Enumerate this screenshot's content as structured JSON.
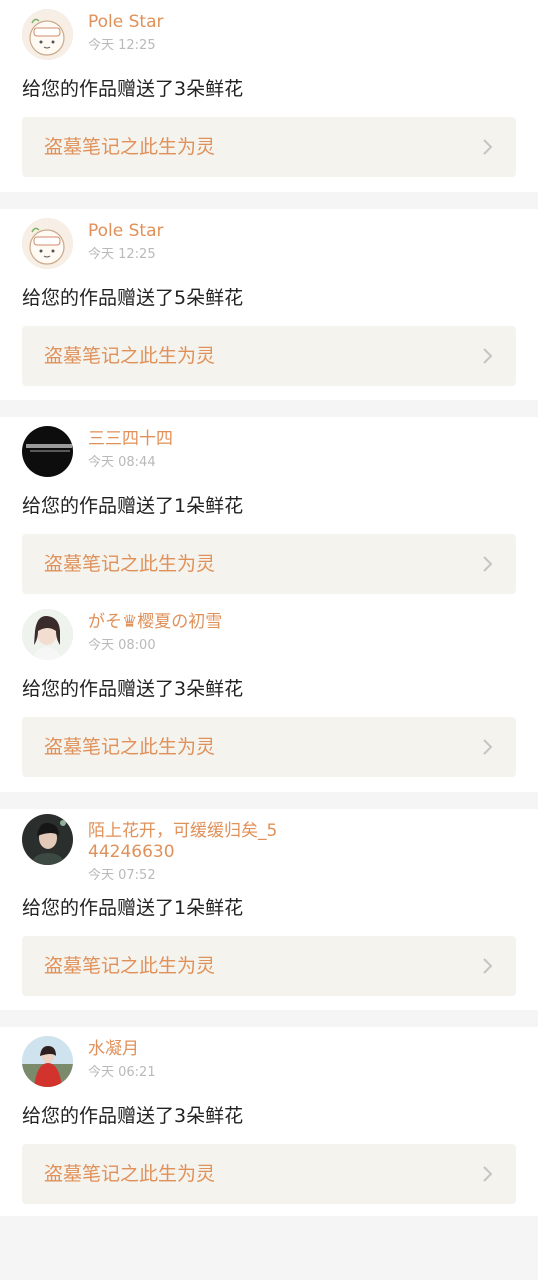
{
  "notifications": [
    {
      "avatar": "avatar-cartoon",
      "user": "Pole Star",
      "time": "今天 12:25",
      "message": "给您的作品赠送了3朵鲜花",
      "work": "盗墓笔记之此生为灵"
    },
    {
      "avatar": "avatar-cartoon",
      "user": "Pole Star",
      "time": "今天 12:25",
      "message": "给您的作品赠送了5朵鲜花",
      "work": "盗墓笔记之此生为灵"
    },
    {
      "avatar": "avatar-dark",
      "user": "三三四十四",
      "time": "今天 08:44",
      "message": "给您的作品赠送了1朵鲜花",
      "work": "盗墓笔记之此生为灵"
    },
    {
      "avatar": "avatar-girl",
      "user": "がそ♛樱夏の初雪",
      "time": "今天 08:00",
      "message": "给您的作品赠送了3朵鲜花",
      "work": "盗墓笔记之此生为灵"
    },
    {
      "avatar": "avatar-portrait",
      "user": "陌上花开，可缓缓归矣_544246630",
      "time": "今天 07:52",
      "message": "给您的作品赠送了1朵鲜花",
      "work": "盗墓笔记之此生为灵"
    },
    {
      "avatar": "avatar-red-dress",
      "user": "水凝月",
      "time": "今天 06:21",
      "message": "给您的作品赠送了3朵鲜花",
      "work": "盗墓笔记之此生为灵"
    }
  ],
  "icons": {
    "chevron": "chevron-right-icon"
  },
  "colors": {
    "accent": "#e0915a",
    "time": "#b9b9b9",
    "work_bg": "#f4f3ee",
    "page_bg": "#f5f5f5"
  }
}
